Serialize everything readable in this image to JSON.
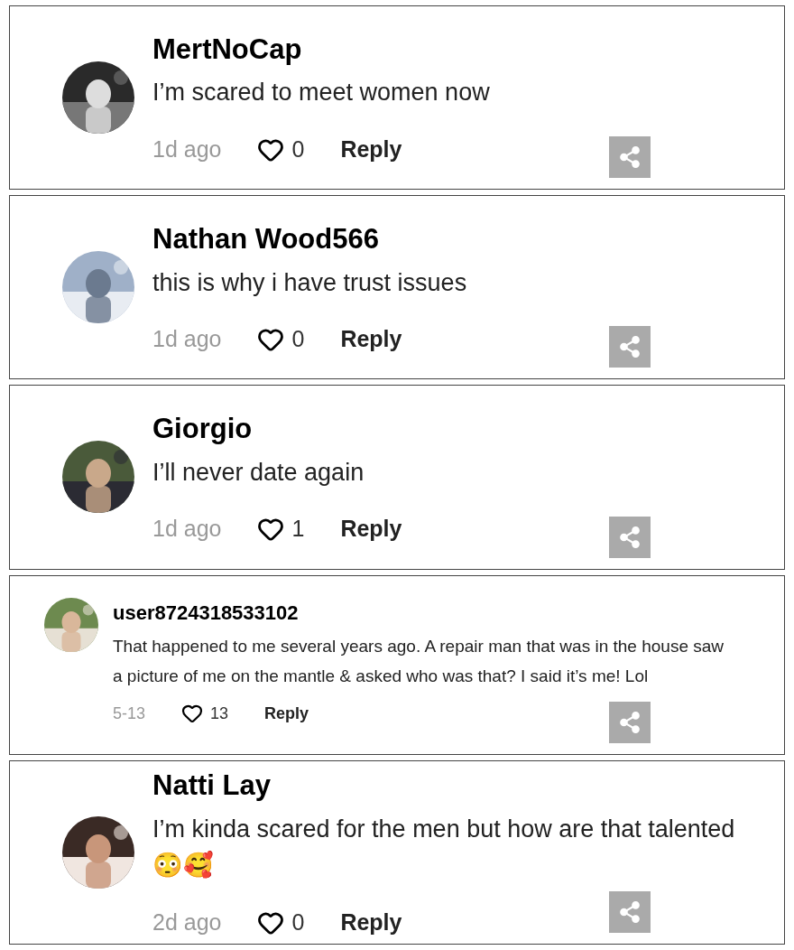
{
  "comments": [
    {
      "kind": "large",
      "username": "MertNoCap",
      "text": "I’m scared to meet women now",
      "time": "1d ago",
      "likes": "0",
      "reply": "Reply"
    },
    {
      "kind": "large",
      "username": "Nathan Wood566",
      "text": "this is why i have trust issues",
      "time": "1d ago",
      "likes": "0",
      "reply": "Reply"
    },
    {
      "kind": "large",
      "username": "Giorgio",
      "text": "I’ll never date again",
      "time": "1d ago",
      "likes": "1",
      "reply": "Reply"
    },
    {
      "kind": "compact",
      "username": "user8724318533102",
      "text": "That happened to me several years ago. A repair man that was in the house saw a picture of me on the mantle & asked who was that? I said it’s me! Lol",
      "time": "5-13",
      "likes": "13",
      "reply": "Reply"
    },
    {
      "kind": "large",
      "username": "Natti Lay",
      "text": "I’m kinda scared for the men but how are that talented 😳🥰",
      "time": "2d ago",
      "likes": "0",
      "reply": "Reply"
    }
  ]
}
